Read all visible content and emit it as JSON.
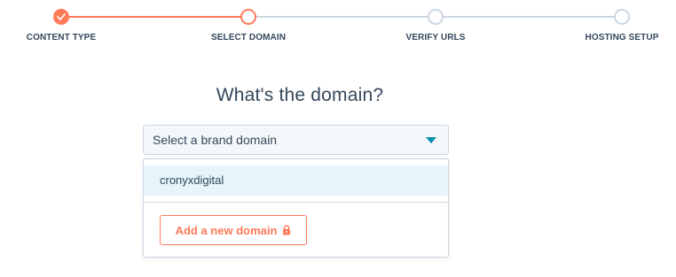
{
  "stepper": {
    "steps": [
      {
        "label": "CONTENT TYPE",
        "status": "complete"
      },
      {
        "label": "SELECT DOMAIN",
        "status": "current"
      },
      {
        "label": "VERIFY URLS",
        "status": "pending"
      },
      {
        "label": "HOSTING SETUP",
        "status": "pending"
      }
    ],
    "complete_icon": "checkmark-icon"
  },
  "main": {
    "heading": "What's the domain?",
    "select": {
      "value": "Select a brand domain",
      "caret_icon": "caret-down-icon"
    },
    "dropdown": {
      "options": [
        {
          "label": "cronyxdigital",
          "highlighted": true
        }
      ],
      "add_button": {
        "label": "Add a new domain",
        "icon": "lock-icon"
      }
    }
  },
  "colors": {
    "accent": "#ff7a59",
    "text": "#33475b",
    "border": "#cbd6e2",
    "select_bg": "#f5f8fa",
    "option_highlight": "#e5f5f8",
    "caret": "#0091ae"
  }
}
